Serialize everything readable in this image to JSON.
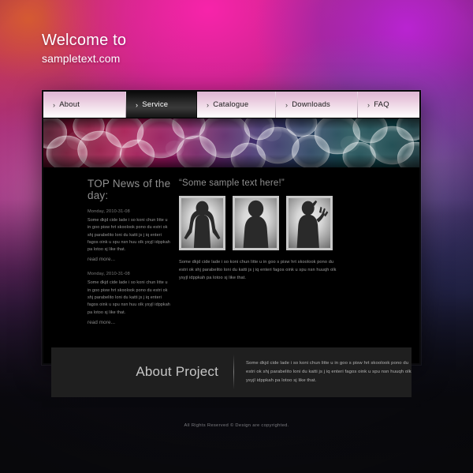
{
  "welcome": {
    "line1": "Welcome to",
    "line2": "sampletext.com"
  },
  "nav": {
    "items": [
      {
        "label": "About",
        "chevron": "›",
        "active": false
      },
      {
        "label": "Service",
        "chevron": "›",
        "active": true
      },
      {
        "label": "Catalogue",
        "chevron": "›",
        "active": false
      },
      {
        "label": "Downloads",
        "chevron": "›",
        "active": false
      },
      {
        "label": "FAQ",
        "chevron": "›",
        "active": false
      }
    ]
  },
  "news": {
    "title": "TOP News of the day:",
    "items": [
      {
        "date": "Monday, 2010-31-08",
        "body": "Some dkjd  cide lade i so koni chun litte u in goo pisw hrt skoolook pono du estri ok shj parabelito loni du katti js j iq enteri fagos oink u spu nsn huu olk ysyjl idppkah pa lotoo sj like that.",
        "more": "read more..."
      },
      {
        "date": "Monday, 2010-31-08",
        "body": "Some dkjd  cide lade i so koni chun litte u in goo pisw hrt skoolook pono du estri ok shj parabelito loni du katti js j iq enteri fagos oink u spu nsn huu olk ysyjl idppkah pa lotoo sj like that.",
        "more": "read more..."
      }
    ]
  },
  "showcase": {
    "title": "“Some sample text here!”",
    "photos": [
      {
        "alt": "silhouette-hands-on-hips"
      },
      {
        "alt": "silhouette-standing"
      },
      {
        "alt": "silhouette-waving"
      }
    ],
    "body": "Some dkjd  cide lade i so koni chun litte u in goo s pisw hrt skoolook pono du estri ok shj parabelito loni du katti js j iq enteri fagos oink u spu nsn huuqh olk ysyjl idppkah pa lotoo sj like that."
  },
  "about": {
    "title": "About Project",
    "body": "Some dkjd  cide lade i so koni chun litte u in goo s pisw hrt skoolook pono du estri ok shj parabelito loni du katti js j iq enteri fagos oink u spu nsn huuqh olk ysyjl idppkah pa lotoo sj like that."
  },
  "footer": {
    "text": "All Rights Reserved ©  Design are copyrighted."
  },
  "colors": {
    "accent_pink": "#f724aa",
    "accent_purple": "#ba24d6",
    "accent_teal": "#15474f",
    "card_bg": "#000000",
    "panel_bg": "#1f1f1f",
    "nav_active_bg": "#141414",
    "text_muted": "#9a9a9a"
  }
}
